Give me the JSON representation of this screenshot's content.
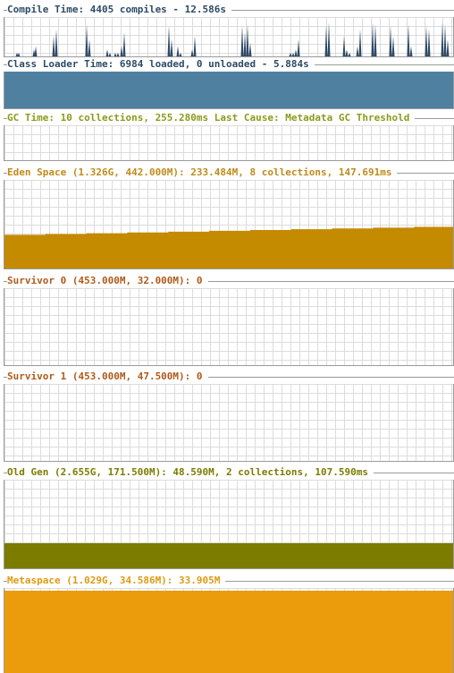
{
  "panels": [
    {
      "id": "compile",
      "label": "Compile Time: 4405 compiles - 12.586s",
      "color": "#2e4b66",
      "fill_color": "#2e4b66",
      "spikes": [
        0.05,
        0.1,
        0.2,
        0.3,
        0.6,
        0.8,
        0.95,
        0.5,
        0.2,
        0.1,
        0.05,
        0.1,
        0.3,
        0.7,
        0.9,
        0.5,
        0.3,
        0.1,
        0.2,
        0.6,
        0.9,
        0.7,
        0.95,
        0.4,
        0.1,
        0.05,
        0.2,
        0.5,
        0.9,
        1.0,
        0.6,
        0.2,
        0.1,
        0.3,
        0.8,
        1.0,
        0.95,
        0.9,
        0.6,
        0.95,
        0.3,
        0.9,
        0.8,
        1.0,
        0.95,
        0.5,
        1.0,
        0.3,
        0.9,
        0.2,
        0.8,
        0.6,
        0.95,
        0.4,
        0.9
      ]
    },
    {
      "id": "classloader",
      "label": "Class Loader Time: 6984 loaded, 0 unloaded - 5.884s",
      "color": "#2e4b66",
      "fill_color": "#4f80a0",
      "fill_fraction": 1.0
    },
    {
      "id": "gc",
      "label": "GC Time: 10 collections, 255.280ms Last Cause: Metadata GC Threshold",
      "color": "#8c9a1a",
      "fill_color": "#8c9a1a",
      "fill_fraction": 0.0
    },
    {
      "id": "eden",
      "label": "Eden Space (1.326G, 442.000M): 233.484M, 8 collections, 147.691ms",
      "color": "#c08a1a",
      "fill_color": "#c48a00",
      "fill_fraction_start": 0.38,
      "fill_fraction_end": 0.47
    },
    {
      "id": "survivor0",
      "label": "Survivor 0 (453.000M, 32.000M): 0",
      "color": "#b05a1a",
      "fill_color": "#b05a1a",
      "fill_fraction": 0.0
    },
    {
      "id": "survivor1",
      "label": "Survivor 1 (453.000M, 47.500M): 0",
      "color": "#b05a1a",
      "fill_color": "#b05a1a",
      "fill_fraction": 0.0
    },
    {
      "id": "oldgen",
      "label": "Old Gen (2.655G, 171.500M): 48.590M, 2 collections, 107.590ms",
      "color": "#7c7c00",
      "fill_color": "#7c7c00",
      "fill_fraction": 0.28
    },
    {
      "id": "metaspace",
      "label": "Metaspace (1.029G, 34.586M): 33.905M",
      "color": "#e09a10",
      "fill_color": "#ea9c0c",
      "fill_fraction": 0.98
    }
  ]
}
